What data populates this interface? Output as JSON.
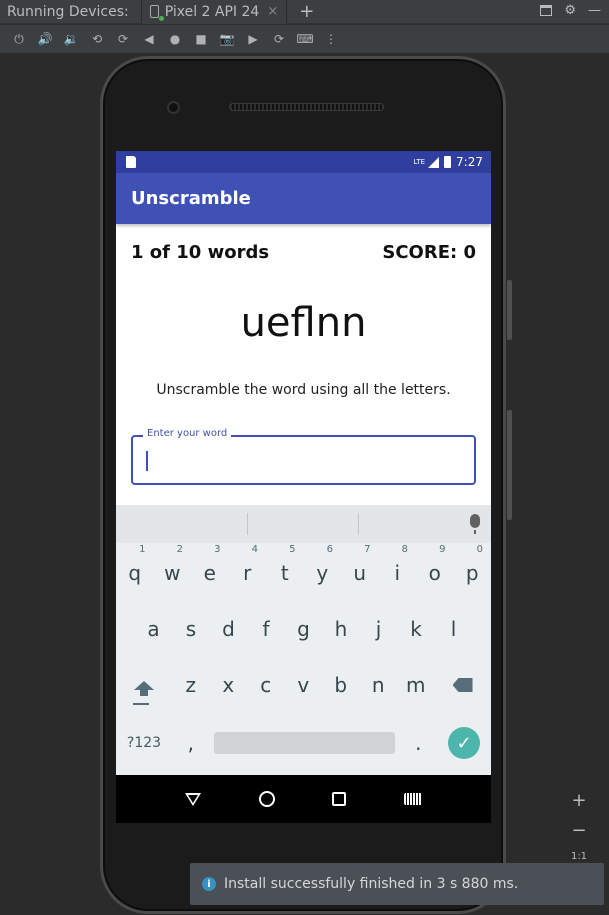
{
  "ide": {
    "title": "Running Devices:",
    "device_tab": "Pixel 2 API 24",
    "tab_close": "×",
    "tab_add": "+",
    "zoom_in": "+",
    "zoom_out": "−",
    "zoom_ratio": "1:1"
  },
  "notification": {
    "message": "Install successfully finished in 3 s 880 ms."
  },
  "device": {
    "status_time": "7:27",
    "status_network": "LTE"
  },
  "app": {
    "title": "Unscramble",
    "word_count": "1 of 10 words",
    "score": "SCORE: 0",
    "scrambled_word": "ueflnn",
    "instructions": "Unscramble the word using all the letters.",
    "input_label": "Enter your word",
    "input_value": ""
  },
  "keyboard": {
    "row1": [
      {
        "key": "q",
        "hint": "1"
      },
      {
        "key": "w",
        "hint": "2"
      },
      {
        "key": "e",
        "hint": "3"
      },
      {
        "key": "r",
        "hint": "4"
      },
      {
        "key": "t",
        "hint": "5"
      },
      {
        "key": "y",
        "hint": "6"
      },
      {
        "key": "u",
        "hint": "7"
      },
      {
        "key": "i",
        "hint": "8"
      },
      {
        "key": "o",
        "hint": "9"
      },
      {
        "key": "p",
        "hint": "0"
      }
    ],
    "row2": [
      "a",
      "s",
      "d",
      "f",
      "g",
      "h",
      "j",
      "k",
      "l"
    ],
    "row3": [
      "z",
      "x",
      "c",
      "v",
      "b",
      "n",
      "m"
    ],
    "symbols_key": "?123",
    "comma_key": ",",
    "period_key": ".",
    "go_key": "✓"
  },
  "colors": {
    "app_bar": "#3f51b5",
    "status_bar": "#303f9f",
    "go_key": "#4db6ac"
  }
}
